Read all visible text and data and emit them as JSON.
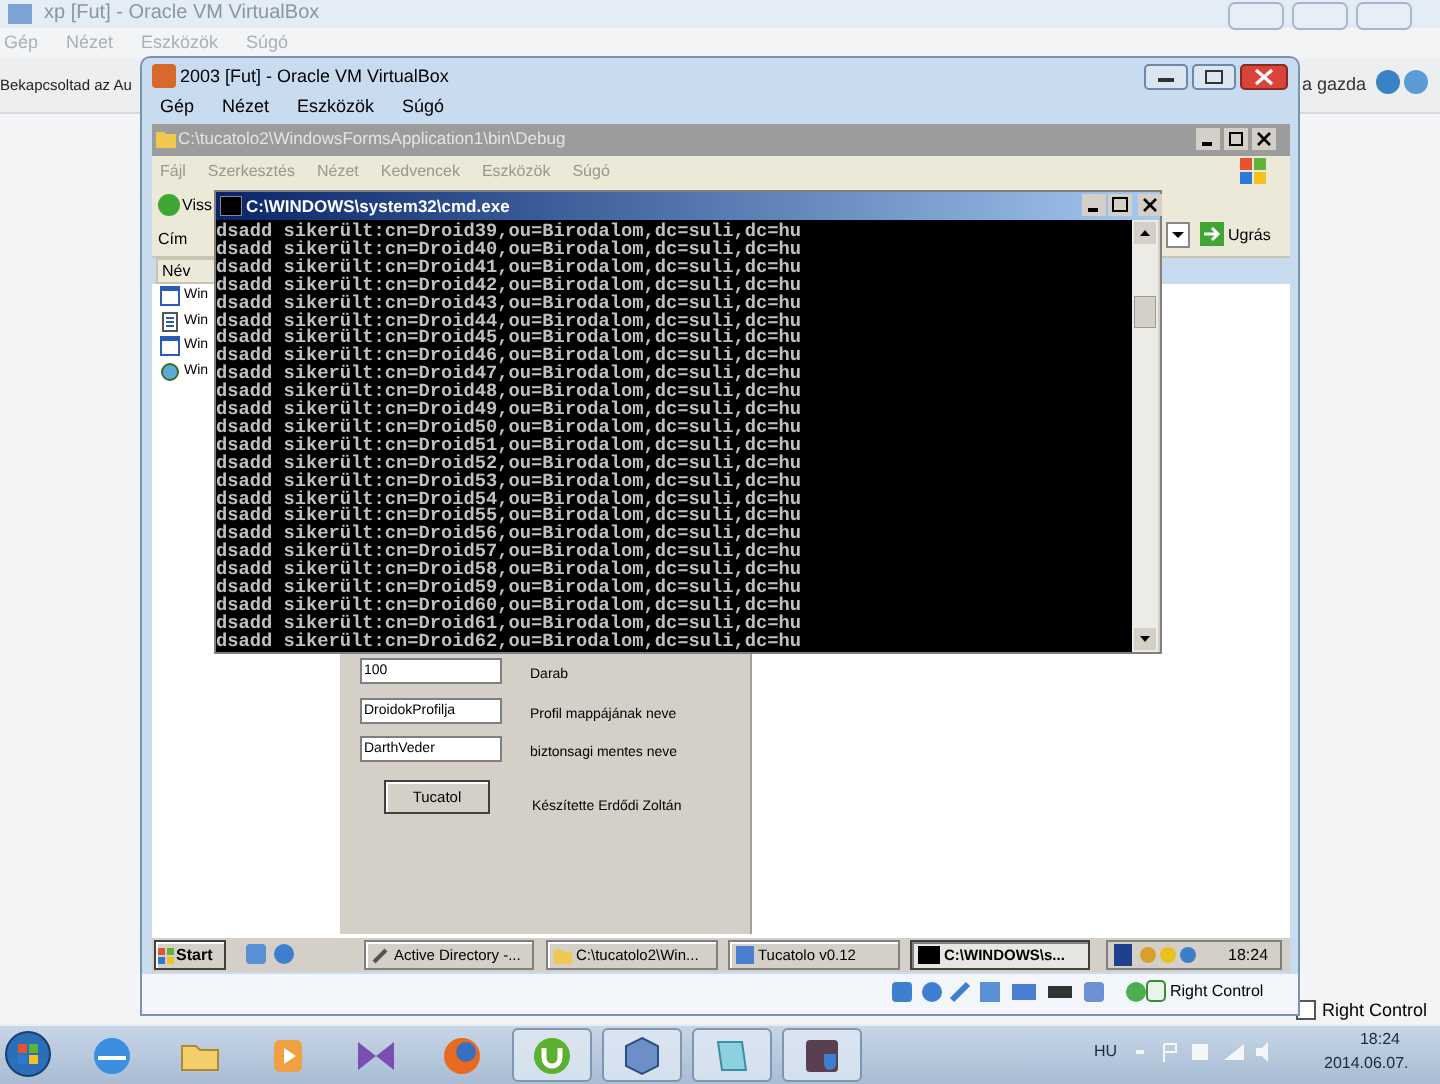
{
  "host_window": {
    "title": "xp [Fut] - Oracle VM VirtualBox",
    "menu": [
      "Gép",
      "Nézet",
      "Eszközök",
      "Súgó"
    ],
    "notice_left": "Bekapcsoltad az Au",
    "notice_right": "a gazda",
    "status_text": "Right Control"
  },
  "vbox_window": {
    "title": "2003 [Fut] - Oracle VM VirtualBox",
    "menu": [
      "Gép",
      "Nézet",
      "Eszközök",
      "Súgó"
    ],
    "status_text": "Right Control"
  },
  "explorer": {
    "title": "C:\\tucatolo2\\WindowsFormsApplication1\\bin\\Debug",
    "menu": [
      "Fájl",
      "Szerkesztés",
      "Nézet",
      "Kedvencek",
      "Eszközök",
      "Súgó"
    ],
    "back_label": "Viss",
    "address_label": "Cím",
    "go_label": "Ugrás",
    "column_header": "Név",
    "files": [
      {
        "name": "Win",
        "kind": "app"
      },
      {
        "name": "Win",
        "kind": "document"
      },
      {
        "name": "Win",
        "kind": "app"
      },
      {
        "name": "Win",
        "kind": "config"
      }
    ]
  },
  "cmd": {
    "title": "C:\\WINDOWS\\system32\\cmd.exe",
    "lines": [
      "dsadd sikerült:cn=Droid39,ou=Birodalom,dc=suli,dc=hu",
      "dsadd sikerült:cn=Droid40,ou=Birodalom,dc=suli,dc=hu",
      "dsadd sikerült:cn=Droid41,ou=Birodalom,dc=suli,dc=hu",
      "dsadd sikerült:cn=Droid42,ou=Birodalom,dc=suli,dc=hu",
      "dsadd sikerült:cn=Droid43,ou=Birodalom,dc=suli,dc=hu",
      "dsadd sikerült:cn=Droid44,ou=Birodalom,dc=suli,dc=hu",
      "dsadd sikerült:cn=Droid45,ou=Birodalom,dc=suli,dc=hu",
      "dsadd sikerült:cn=Droid46,ou=Birodalom,dc=suli,dc=hu",
      "dsadd sikerült:cn=Droid47,ou=Birodalom,dc=suli,dc=hu",
      "dsadd sikerült:cn=Droid48,ou=Birodalom,dc=suli,dc=hu",
      "dsadd sikerült:cn=Droid49,ou=Birodalom,dc=suli,dc=hu",
      "dsadd sikerült:cn=Droid50,ou=Birodalom,dc=suli,dc=hu",
      "dsadd sikerült:cn=Droid51,ou=Birodalom,dc=suli,dc=hu",
      "dsadd sikerült:cn=Droid52,ou=Birodalom,dc=suli,dc=hu",
      "dsadd sikerült:cn=Droid53,ou=Birodalom,dc=suli,dc=hu",
      "dsadd sikerült:cn=Droid54,ou=Birodalom,dc=suli,dc=hu",
      "dsadd sikerült:cn=Droid55,ou=Birodalom,dc=suli,dc=hu",
      "dsadd sikerült:cn=Droid56,ou=Birodalom,dc=suli,dc=hu",
      "dsadd sikerült:cn=Droid57,ou=Birodalom,dc=suli,dc=hu",
      "dsadd sikerült:cn=Droid58,ou=Birodalom,dc=suli,dc=hu",
      "dsadd sikerült:cn=Droid59,ou=Birodalom,dc=suli,dc=hu",
      "dsadd sikerült:cn=Droid60,ou=Birodalom,dc=suli,dc=hu",
      "dsadd sikerült:cn=Droid61,ou=Birodalom,dc=suli,dc=hu",
      "dsadd sikerült:cn=Droid62,ou=Birodalom,dc=suli,dc=hu"
    ]
  },
  "form": {
    "fields": [
      {
        "value": "100",
        "label": "Darab"
      },
      {
        "value": "DroidokProfilja",
        "label": "Profil mappájának neve"
      },
      {
        "value": "DarthVeder",
        "label": "biztonsagi mentes neve"
      }
    ],
    "button": "Tucatol",
    "credit": "Készítette Erdődi Zoltán"
  },
  "guest_taskbar": {
    "start": "Start",
    "tasks": [
      {
        "label": "Active Directory -...",
        "kind": "tool",
        "selected": false
      },
      {
        "label": "C:\\tucatolo2\\Win...",
        "kind": "folder",
        "selected": false
      },
      {
        "label": "Tucatolo v0.12",
        "kind": "app",
        "selected": false
      },
      {
        "label": "C:\\WINDOWS\\s...",
        "kind": "console",
        "selected": true
      }
    ],
    "clock": "18:24"
  },
  "host_taskbar": {
    "apps": [
      {
        "kind": "browser-e",
        "running": false
      },
      {
        "kind": "folder",
        "running": false
      },
      {
        "kind": "media",
        "running": false
      },
      {
        "kind": "studio",
        "running": false
      },
      {
        "kind": "fox",
        "running": false
      },
      {
        "kind": "torrent",
        "running": true
      },
      {
        "kind": "cube",
        "running": true
      },
      {
        "kind": "note",
        "running": true
      },
      {
        "kind": "shield",
        "running": true
      }
    ],
    "language": "HU",
    "time": "18:24",
    "date": "2014.06.07."
  }
}
